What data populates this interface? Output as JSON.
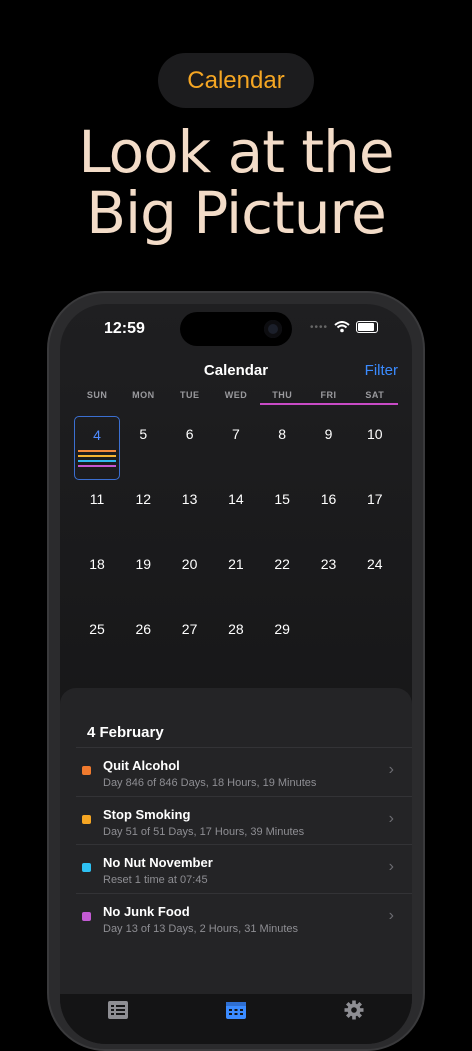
{
  "promo": {
    "pill_label": "Calendar",
    "headline_line1": "Look at the",
    "headline_line2": "Big Picture"
  },
  "status_bar": {
    "time": "12:59",
    "dots": "••••"
  },
  "nav": {
    "title": "Calendar",
    "filter_label": "Filter"
  },
  "calendar": {
    "weekdays": [
      "SUN",
      "MON",
      "TUE",
      "WED",
      "THU",
      "FRI",
      "SAT"
    ],
    "weeks": [
      [
        "4",
        "5",
        "6",
        "7",
        "8",
        "9",
        "10"
      ],
      [
        "11",
        "12",
        "13",
        "14",
        "15",
        "16",
        "17"
      ],
      [
        "18",
        "19",
        "20",
        "21",
        "22",
        "23",
        "24"
      ],
      [
        "25",
        "26",
        "27",
        "28",
        "29",
        "",
        ""
      ]
    ],
    "today": "4",
    "weekend_line_color": "#c84bc6",
    "today_marker_colors": [
      "#f28a3c",
      "#f5b331",
      "#31b8f0",
      "#c556d1"
    ]
  },
  "sheet": {
    "date": "4 February",
    "items": [
      {
        "color": "#f07a2e",
        "title": "Quit Alcohol",
        "subtitle": "Day 846 of 846 Days, 18 Hours, 19 Minutes",
        "chevron": "›"
      },
      {
        "color": "#f5a623",
        "title": "Stop Smoking",
        "subtitle": "Day 51 of 51 Days, 17 Hours, 39 Minutes",
        "chevron": "›"
      },
      {
        "color": "#2ec1f3",
        "title": "No Nut November",
        "subtitle": "Reset 1 time at 07:45",
        "chevron": "›"
      },
      {
        "color": "#c35bd3",
        "title": "No Junk Food",
        "subtitle": "Day 13 of 13 Days, 2 Hours, 31 Minutes",
        "chevron": "›"
      }
    ]
  },
  "tabbar": {
    "tabs": [
      {
        "icon": "list-icon",
        "active": false
      },
      {
        "icon": "calendar-icon",
        "active": true
      },
      {
        "icon": "gear-icon",
        "active": false
      }
    ],
    "accent": "#3b8bff",
    "inactive_color": "#8e8e93"
  }
}
